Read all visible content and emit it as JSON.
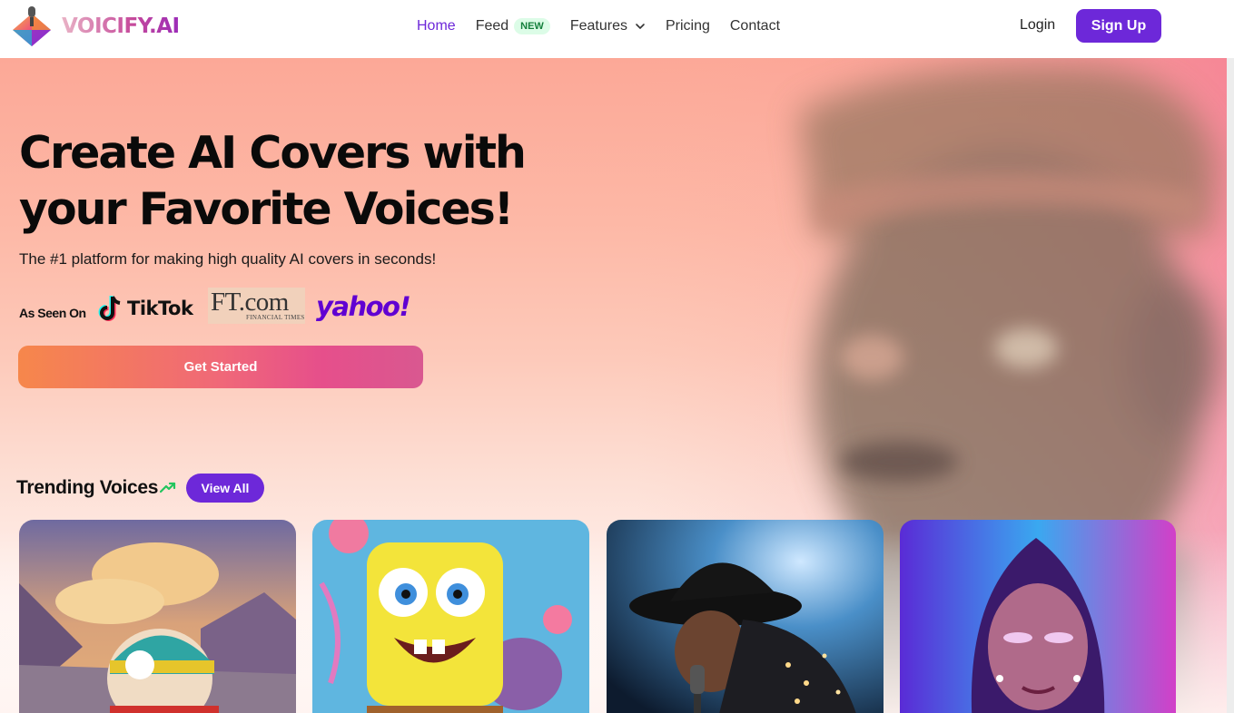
{
  "brand": {
    "name": "VOICIFY.AI",
    "logo_icon": "microphone-diamond-icon"
  },
  "nav": {
    "home": "Home",
    "feed": "Feed",
    "feed_badge": "NEW",
    "features": "Features",
    "pricing": "Pricing",
    "contact": "Contact",
    "login": "Login",
    "signup": "Sign Up"
  },
  "hero": {
    "headline_line1": "Create AI Covers with",
    "headline_line2": "your Favorite Voices!",
    "subtitle": "The #1 platform for making high quality AI covers in seconds!",
    "as_seen_on": "As Seen On",
    "press": {
      "tiktok": "TikTok",
      "ft_main": "FT.com",
      "ft_sub": "FINANCIAL TIMES",
      "yahoo": "yahoo!"
    },
    "cta": "Get Started"
  },
  "trending": {
    "title": "Trending Voices",
    "icon": "trending-up-icon",
    "view_all": "View All"
  },
  "colors": {
    "accent": "#6d28d9",
    "cta_start": "#f6874b",
    "cta_end": "#d95890",
    "badge_bg": "#dcfce7",
    "badge_text": "#15803d",
    "yahoo": "#6001d2"
  }
}
